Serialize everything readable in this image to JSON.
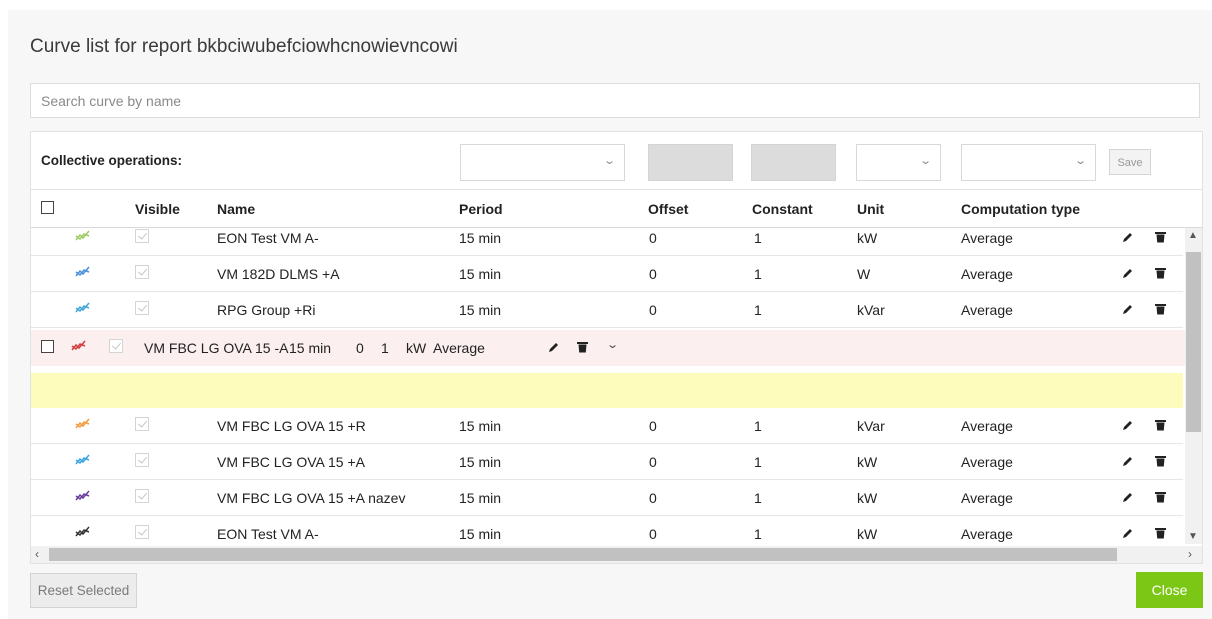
{
  "modal": {
    "title": "Curve list for report bkbciwubefciowhcnowievncowi",
    "search_placeholder": "Search curve by name"
  },
  "collective": {
    "label": "Collective operations:",
    "save_label": "Save"
  },
  "columns": {
    "visible": "Visible",
    "name": "Name",
    "period": "Period",
    "offset": "Offset",
    "constant": "Constant",
    "unit": "Unit",
    "computation_type": "Computation type"
  },
  "rows": [
    {
      "color": "#9ccc65",
      "name": "EON Test VM A-",
      "period": "15 min",
      "offset": "0",
      "constant": "1",
      "unit": "kW",
      "computation": "Average"
    },
    {
      "color": "#4a90d9",
      "name": "VM 182D DLMS +A",
      "period": "15 min",
      "offset": "0",
      "constant": "1",
      "unit": "W",
      "computation": "Average"
    },
    {
      "color": "#42a5d8",
      "name": "RPG Group +Ri",
      "period": "15 min",
      "offset": "0",
      "constant": "1",
      "unit": "kVar",
      "computation": "Average"
    }
  ],
  "dragged_row": {
    "color": "#d23c3c",
    "name": "VM FBC LG OVA 15 -A",
    "period": "15 min",
    "offset": "0",
    "constant": "1",
    "unit": "kW",
    "computation": "Average"
  },
  "rows_after": [
    {
      "color": "#f39c3c",
      "name": "VM FBC LG OVA 15 +R",
      "period": "15 min",
      "offset": "0",
      "constant": "1",
      "unit": "kVar",
      "computation": "Average"
    },
    {
      "color": "#3aa3e3",
      "name": "VM FBC LG OVA 15 +A",
      "period": "15 min",
      "offset": "0",
      "constant": "1",
      "unit": "kW",
      "computation": "Average"
    },
    {
      "color": "#6a3d9a",
      "name": "VM FBC LG OVA 15 +A nazev",
      "period": "15 min",
      "offset": "0",
      "constant": "1",
      "unit": "kW",
      "computation": "Average"
    },
    {
      "color": "#333333",
      "name": "EON Test VM A-",
      "period": "15 min",
      "offset": "0",
      "constant": "1",
      "unit": "kW",
      "computation": "Average"
    }
  ],
  "footer": {
    "reset_label": "Reset Selected",
    "close_label": "Close"
  }
}
